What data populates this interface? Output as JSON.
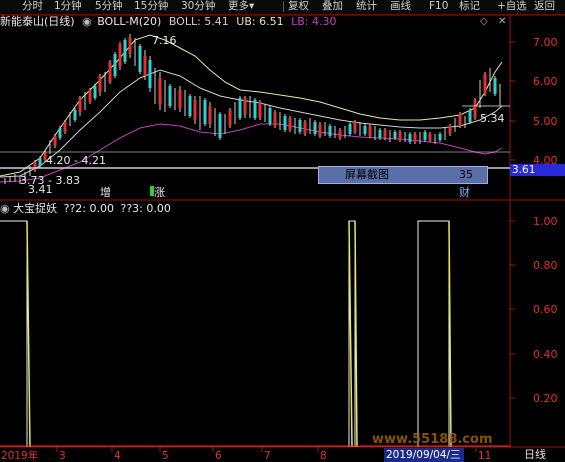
{
  "toolbar": {
    "items": [
      "分时",
      "1分钟",
      "5分钟",
      "15分钟",
      "30分钟",
      "更多▾",
      "复权",
      "叠加",
      "统计",
      "画线",
      "F10",
      "标记",
      "+自选",
      "返回"
    ],
    "menu_icon": "caret-down-icon",
    "diamond_icon": "diamond-icon"
  },
  "upper_panel": {
    "stock_name": "新能泰山(日线)",
    "indicator": "BOLL-M(20)",
    "boll_label": "BOLL: 5.41",
    "ub_label": "UB: 6.51",
    "lb_label": "LB: 4.30",
    "colors": {
      "boll": "#d0d0d0",
      "ub": "#e8e8a0",
      "lb": "#c040c0"
    },
    "y_ticks": [
      "7.00",
      "6.00",
      "5.00",
      "4.00"
    ],
    "annotations": {
      "high": "7.16",
      "mid": "4.20 - 4.21",
      "low_range": "3.73 - 3.83",
      "low": "3.41",
      "right": "5.34"
    },
    "markers": {
      "zeng": "增",
      "zhang": "涨",
      "cai": "财"
    },
    "price_tag": "3.61",
    "screenshot_tip": {
      "label": "屏幕截图",
      "value": "35"
    }
  },
  "lower_panel": {
    "indicator": "大宝捉妖",
    "v1": "??2: 0.00",
    "v2": "??3: 0.00",
    "y_ticks": [
      "1.00",
      "0.80",
      "0.60",
      "0.40",
      "0.20"
    ]
  },
  "x_axis": {
    "labels": [
      "2019年",
      "3",
      "4",
      "5",
      "6",
      "7",
      "8",
      "11"
    ],
    "cursor_date": "2019/09/04/三",
    "period": "日线"
  },
  "watermark": "www.55188.com"
}
